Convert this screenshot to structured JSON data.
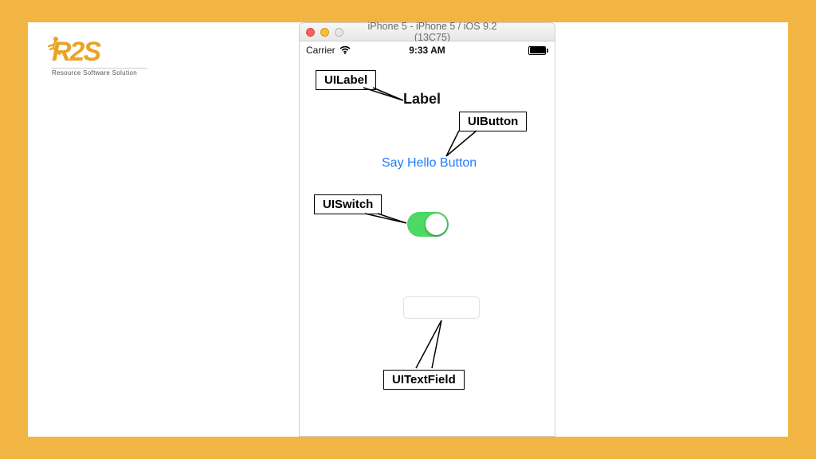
{
  "logo": {
    "text": "R2S",
    "tagline": "Resource Software Solution"
  },
  "window": {
    "title": "iPhone 5 - iPhone 5 / iOS 9.2 (13C75)"
  },
  "statusbar": {
    "carrier": "Carrier",
    "time": "9:33 AM"
  },
  "screen": {
    "label_text": "Label",
    "button_text": "Say Hello Button",
    "textfield_value": ""
  },
  "callouts": {
    "uilabel": "UILabel",
    "uibutton": "UIButton",
    "uiswitch": "UISwitch",
    "uitextfield": "UITextField"
  },
  "colors": {
    "frame": "#f2b443",
    "link": "#1e7cff",
    "switch_on": "#4cd964",
    "logo": "#e9a426"
  }
}
